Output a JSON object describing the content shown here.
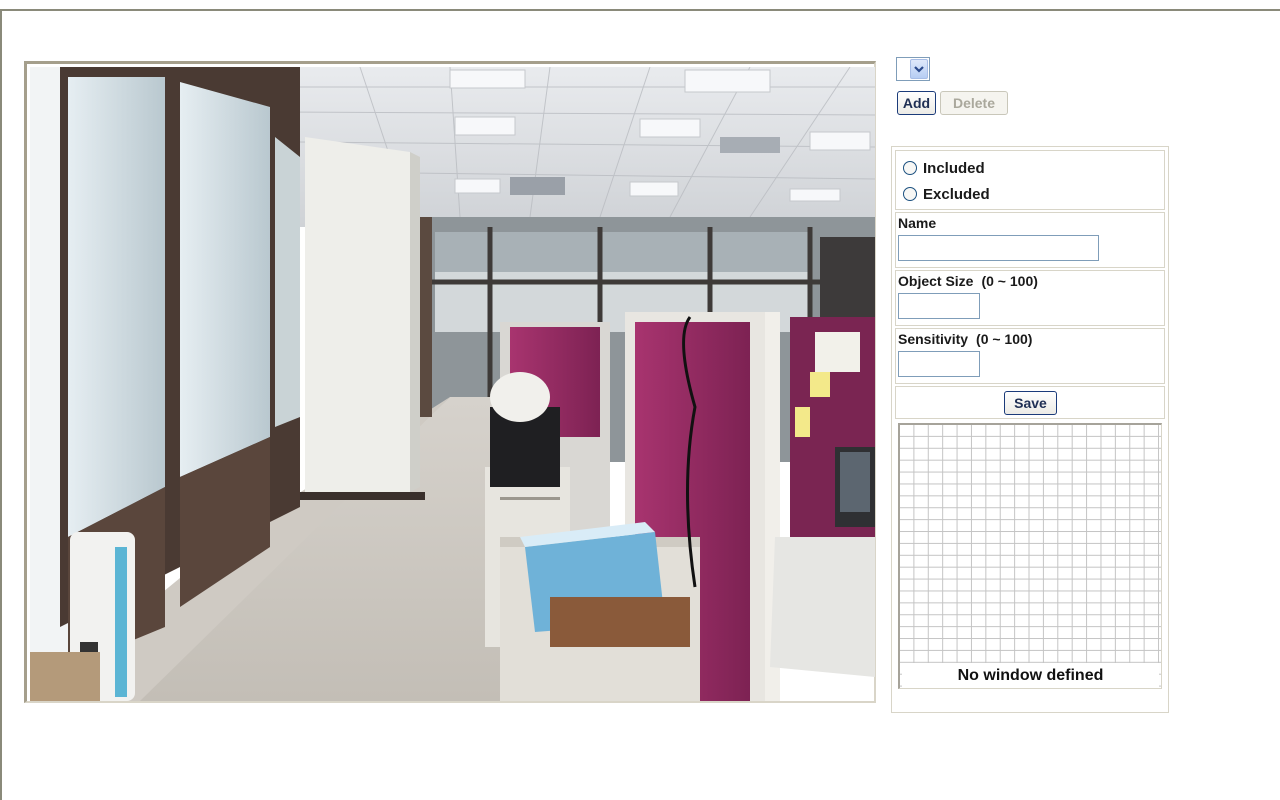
{
  "window_selector": {
    "selected": ""
  },
  "buttons": {
    "add": "Add",
    "delete": "Delete",
    "save": "Save"
  },
  "mode": {
    "included": "Included",
    "excluded": "Excluded"
  },
  "fields": {
    "name_label": "Name",
    "name_value": "",
    "object_size_label": "Object Size",
    "object_size_range": "(0 ~ 100)",
    "object_size_value": "",
    "sensitivity_label": "Sensitivity",
    "sensitivity_range": "(0 ~ 100)",
    "sensitivity_value": ""
  },
  "grid_message": "No window defined"
}
